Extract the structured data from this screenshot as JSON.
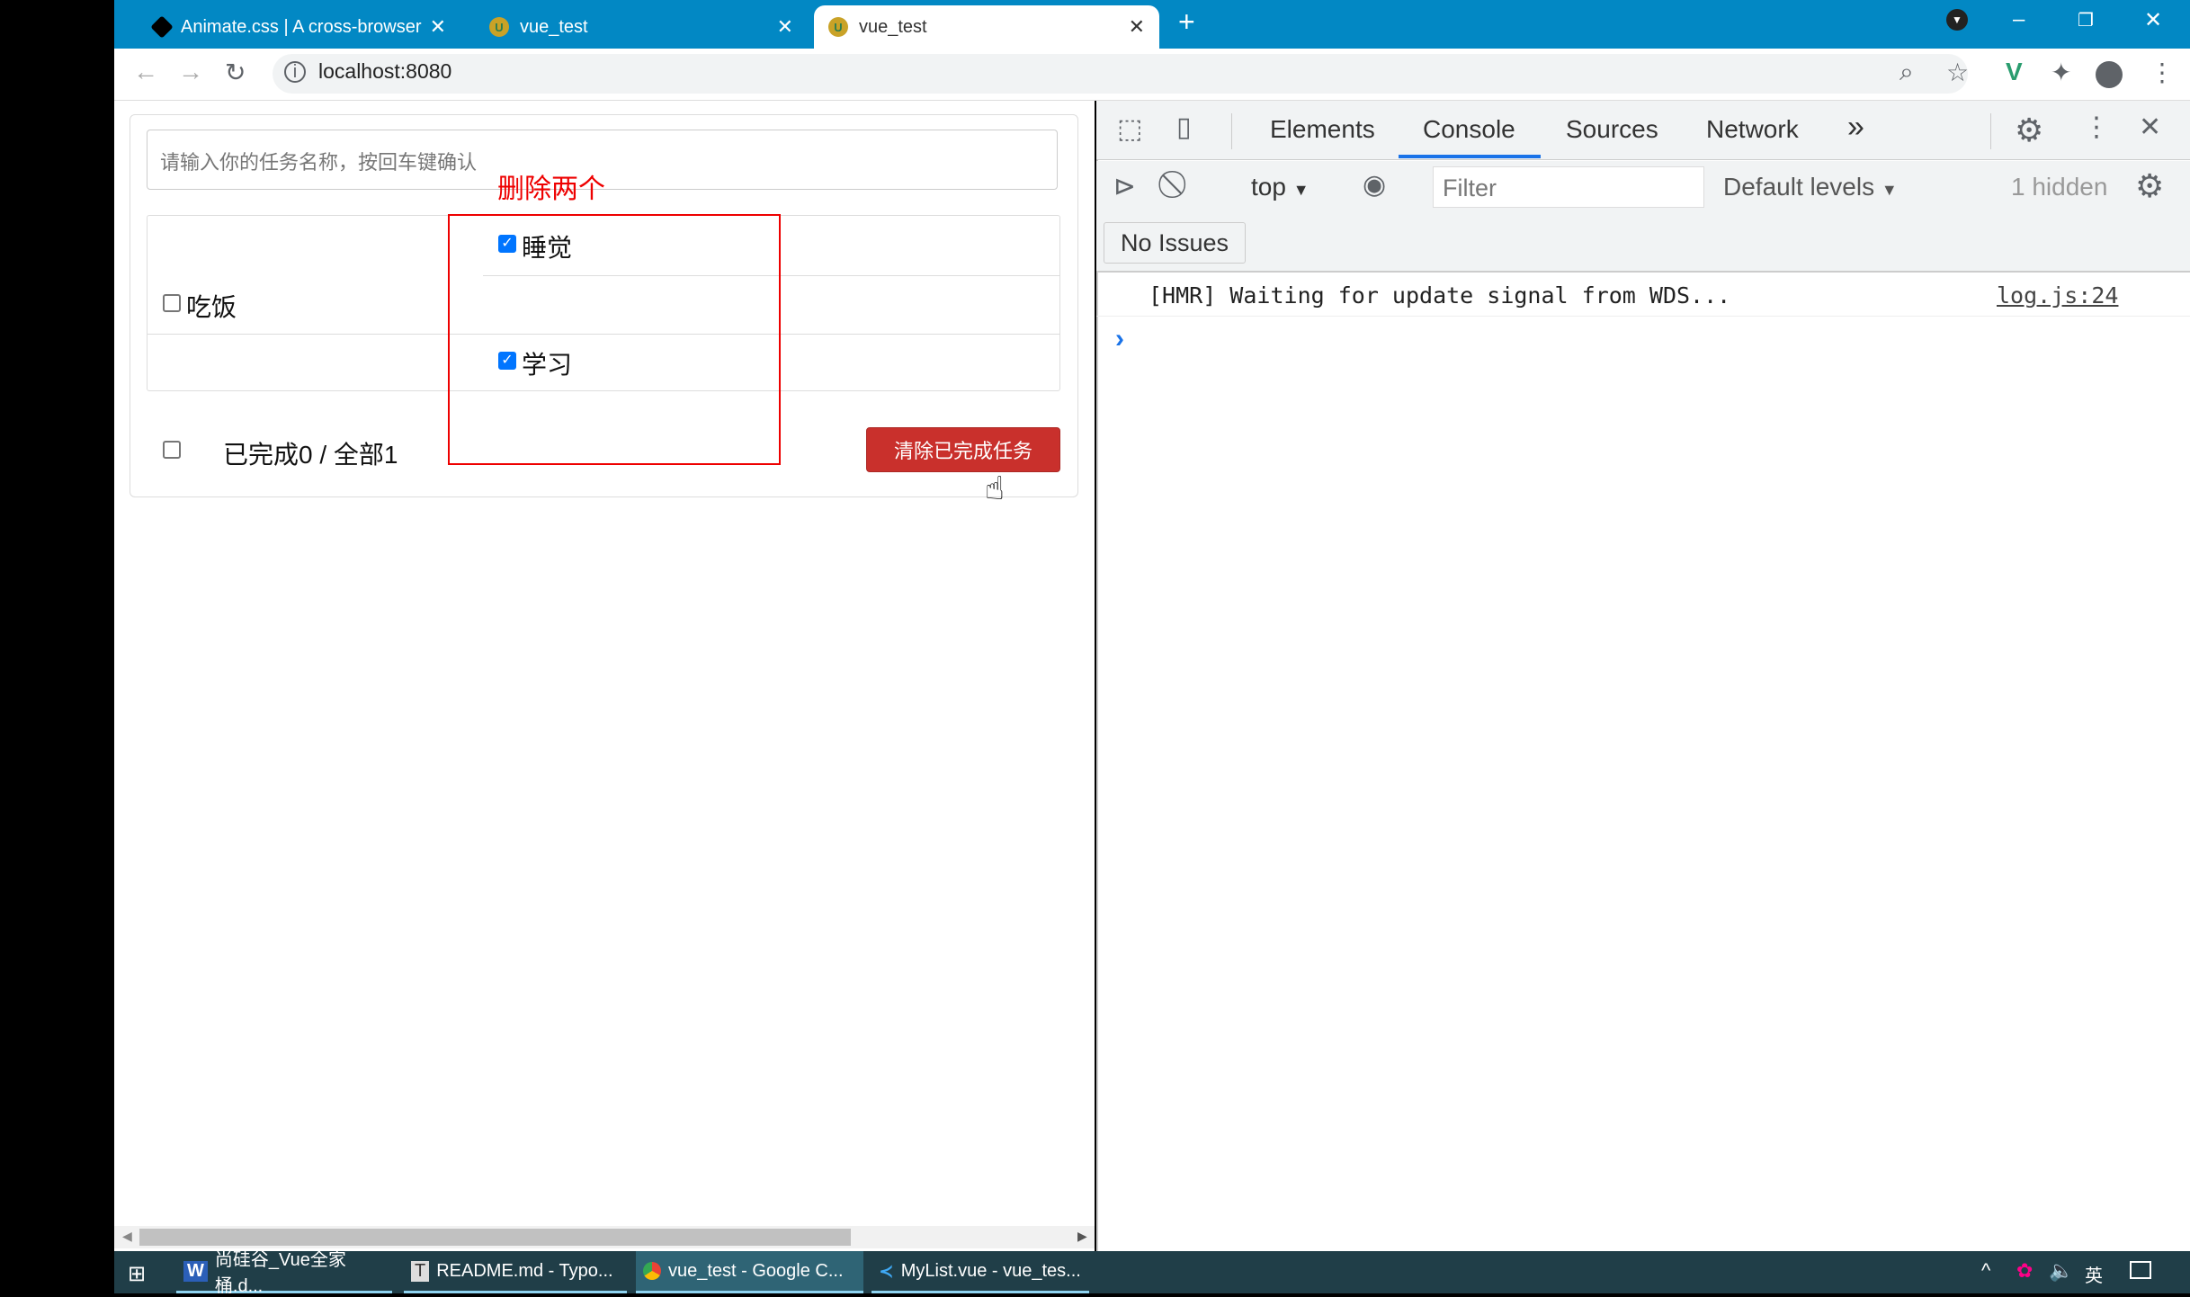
{
  "browser": {
    "tabs": [
      {
        "title": "Animate.css | A cross-browser",
        "icon": "animate-icon"
      },
      {
        "title": "vue_test",
        "icon": "vue-icon"
      },
      {
        "title": "vue_test",
        "icon": "vue-icon",
        "active": true
      }
    ],
    "url": "localhost:8080",
    "accent": "#0288c4"
  },
  "app": {
    "input_placeholder": "请输入你的任务名称，按回车键确认",
    "todos": [
      {
        "title": "吃饭",
        "done": false
      },
      {
        "title": "睡觉",
        "done": true
      },
      {
        "title": "学习",
        "done": true
      }
    ],
    "footer_text": "已完成0 / 全部1",
    "clear_button": "清除已完成任务",
    "annotation": "删除两个"
  },
  "devtools": {
    "tabs": [
      "Elements",
      "Console",
      "Sources",
      "Network"
    ],
    "active_tab": "Console",
    "more": "»",
    "context": "top",
    "filter_placeholder": "Filter",
    "levels": "Default levels",
    "hidden": "1 hidden",
    "issues": "No Issues",
    "messages": [
      {
        "text": "[HMR] Waiting for update signal from WDS...",
        "source": "log.js:24"
      }
    ],
    "prompt": "›"
  },
  "taskbar": {
    "items": [
      {
        "label": "尚硅谷_Vue全家桶.d...",
        "icon": "word-icon"
      },
      {
        "label": "README.md - Typo...",
        "icon": "typora-icon"
      },
      {
        "label": "vue_test - Google C...",
        "icon": "chrome-icon",
        "active": true
      },
      {
        "label": "MyList.vue - vue_tes...",
        "icon": "vscode-icon"
      }
    ],
    "ime": "英"
  }
}
